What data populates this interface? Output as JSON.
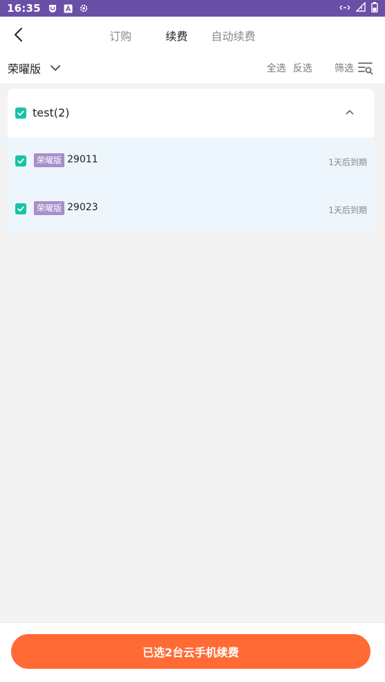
{
  "status_bar": {
    "time": "16:35",
    "left_icons": [
      "shield-icon",
      "a-icon",
      "settings-icon"
    ],
    "right_icons": [
      "data-arrows-icon",
      "signal-icon",
      "battery-icon"
    ],
    "background": "#6a4fa6"
  },
  "header": {
    "tabs": [
      {
        "label": "订购",
        "active": false
      },
      {
        "label": "续费",
        "active": true
      },
      {
        "label": "自动续费",
        "active": false
      }
    ]
  },
  "filter_bar": {
    "version_label": "荣曜版",
    "select_all": "全选",
    "invert": "反选",
    "filter": "筛选"
  },
  "group": {
    "title": "test(2)",
    "checked": true,
    "items": [
      {
        "badge": "荣曜版",
        "id": "29011",
        "expire": "1天后到期",
        "checked": true
      },
      {
        "badge": "荣曜版",
        "id": "29023",
        "expire": "1天后到期",
        "checked": true
      }
    ]
  },
  "bottom": {
    "button_label": "已选2台云手机续费",
    "accent": "#ff6a35"
  },
  "colors": {
    "check_green": "#17c3a5",
    "badge_purple": "#a68ec7",
    "item_bg": "#edf5fd"
  }
}
